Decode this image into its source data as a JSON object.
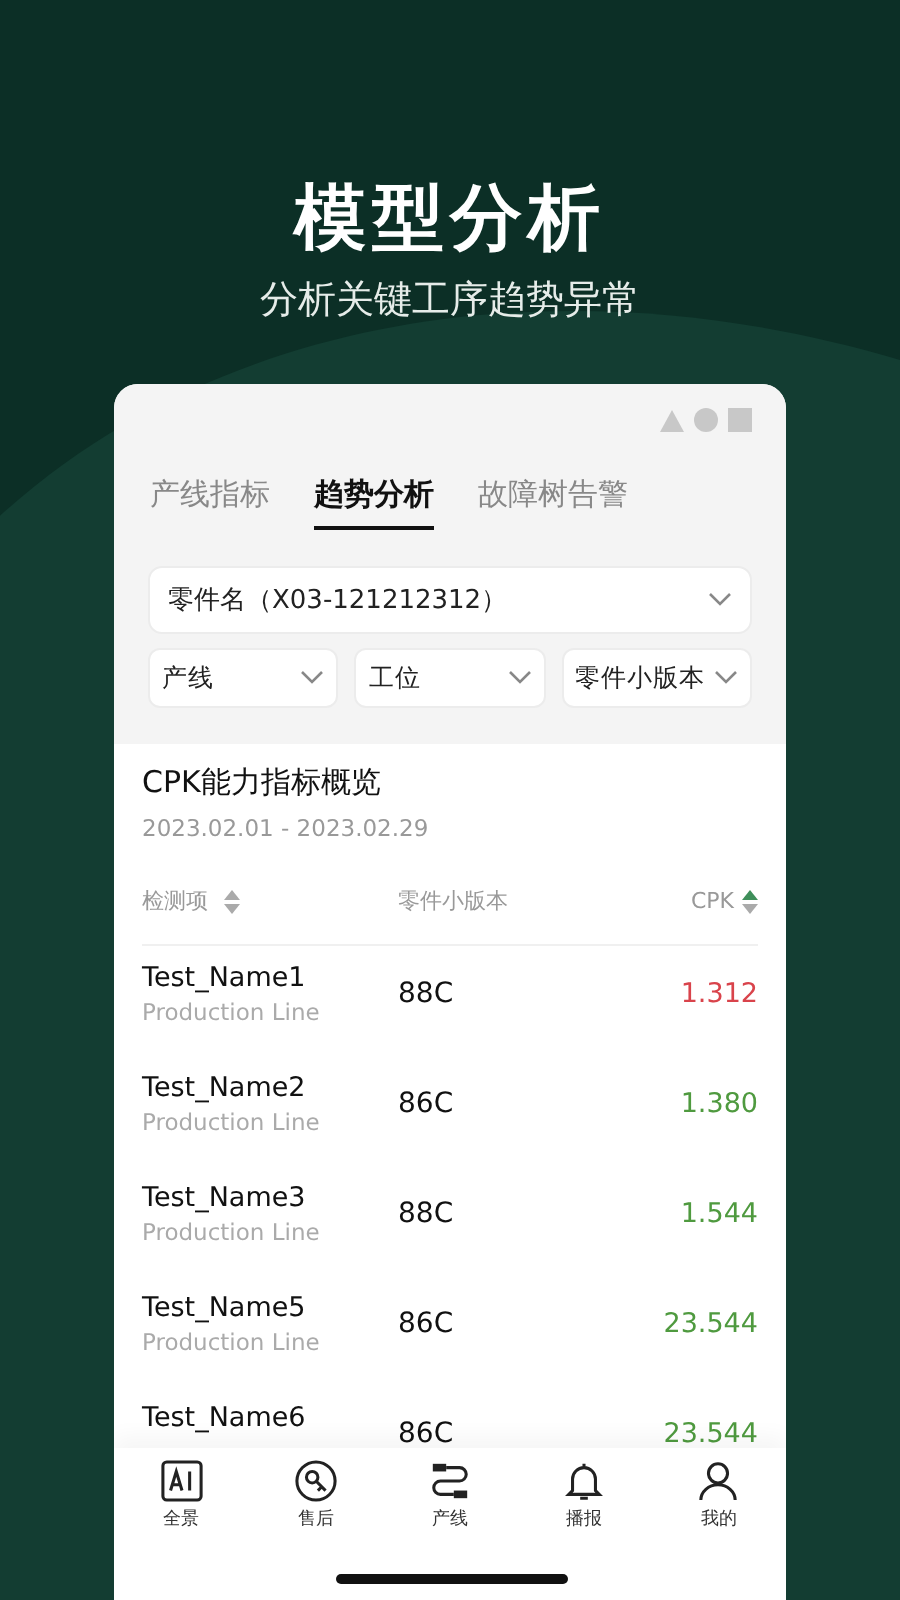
{
  "header": {
    "title": "模型分析",
    "subtitle": "分析关键工序趋势异常"
  },
  "tabs": [
    {
      "label": "产线指标",
      "selected": false
    },
    {
      "label": "趋势分析",
      "selected": true
    },
    {
      "label": "故障树告警",
      "selected": false
    }
  ],
  "part_select": {
    "value": "零件名（X03-121212312）"
  },
  "filters": [
    {
      "value": "产线"
    },
    {
      "value": "工位"
    },
    {
      "value": "零件小版本"
    }
  ],
  "section": {
    "title": "CPK能力指标概览",
    "date_range": "2023.02.01 - 2023.02.29"
  },
  "table": {
    "columns": [
      {
        "label": "检测项",
        "sorted": false
      },
      {
        "label": "零件小版本"
      },
      {
        "label": "CPK",
        "sorted": true
      }
    ],
    "rows": [
      {
        "name": "Test_Name1",
        "line": "Production Line",
        "version": "88C",
        "cpk": "1.312",
        "color": "#d9434b"
      },
      {
        "name": "Test_Name2",
        "line": "Production Line",
        "version": "86C",
        "cpk": "1.380",
        "color": "#4f9a3f"
      },
      {
        "name": "Test_Name3",
        "line": "Production Line",
        "version": "88C",
        "cpk": "1.544",
        "color": "#4f9a3f"
      },
      {
        "name": "Test_Name5",
        "line": "Production Line",
        "version": "86C",
        "cpk": "23.544",
        "color": "#4f9a3f"
      },
      {
        "name": "Test_Name6",
        "version": "86C",
        "cpk": "23.544",
        "color": "#4f9a3f"
      }
    ]
  },
  "nav": [
    {
      "label": "全景",
      "kind": "ai"
    },
    {
      "label": "售后",
      "kind": "wrench"
    },
    {
      "label": "产线",
      "kind": "cable"
    },
    {
      "label": "播报",
      "kind": "bell"
    },
    {
      "label": "我的",
      "kind": "person"
    }
  ]
}
